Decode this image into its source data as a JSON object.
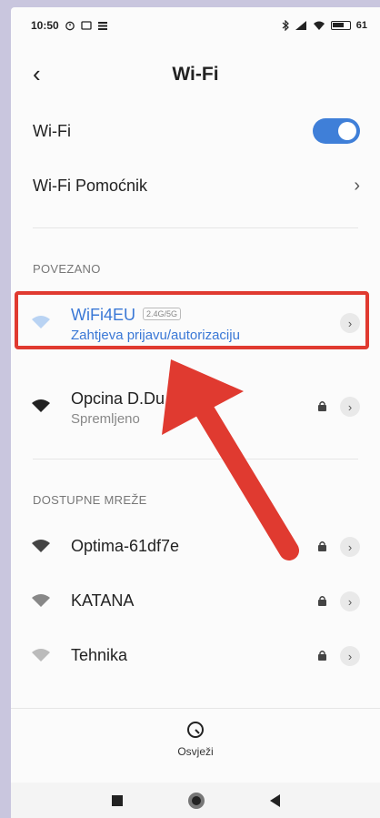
{
  "status_bar": {
    "time": "10:50",
    "battery": "61"
  },
  "header": {
    "title": "Wi-Fi",
    "back_symbol": "‹"
  },
  "settings": {
    "wifi_label": "Wi-Fi",
    "wifi_enabled": true,
    "assistant_label": "Wi-Fi Pomoćnik",
    "assistant_chevron": "›"
  },
  "connected_section": {
    "title": "POVEZANO",
    "networks": [
      {
        "name": "WiFi4EU",
        "badge": "2.4G/5G",
        "status": "Zahtjeva prijavu/autorizaciju",
        "locked": false
      },
      {
        "name": "Opcina D.Du",
        "status": "Spremljeno",
        "locked": true
      }
    ]
  },
  "available_section": {
    "title": "DOSTUPNE MREŽE",
    "networks": [
      {
        "name": "Optima-61df7e",
        "locked": true
      },
      {
        "name": "KATANA",
        "locked": true
      },
      {
        "name": "Tehnika",
        "locked": true
      }
    ]
  },
  "footer": {
    "refresh_label": "Osvježi"
  },
  "colors": {
    "accent": "#3f7fd8",
    "highlight": "#e03a30",
    "link": "#3a78d6"
  },
  "icons": [
    "wifi-icon",
    "lock-icon",
    "chevron-right-icon",
    "refresh-icon",
    "alarm-icon",
    "bluetooth-icon",
    "signal-icon"
  ]
}
